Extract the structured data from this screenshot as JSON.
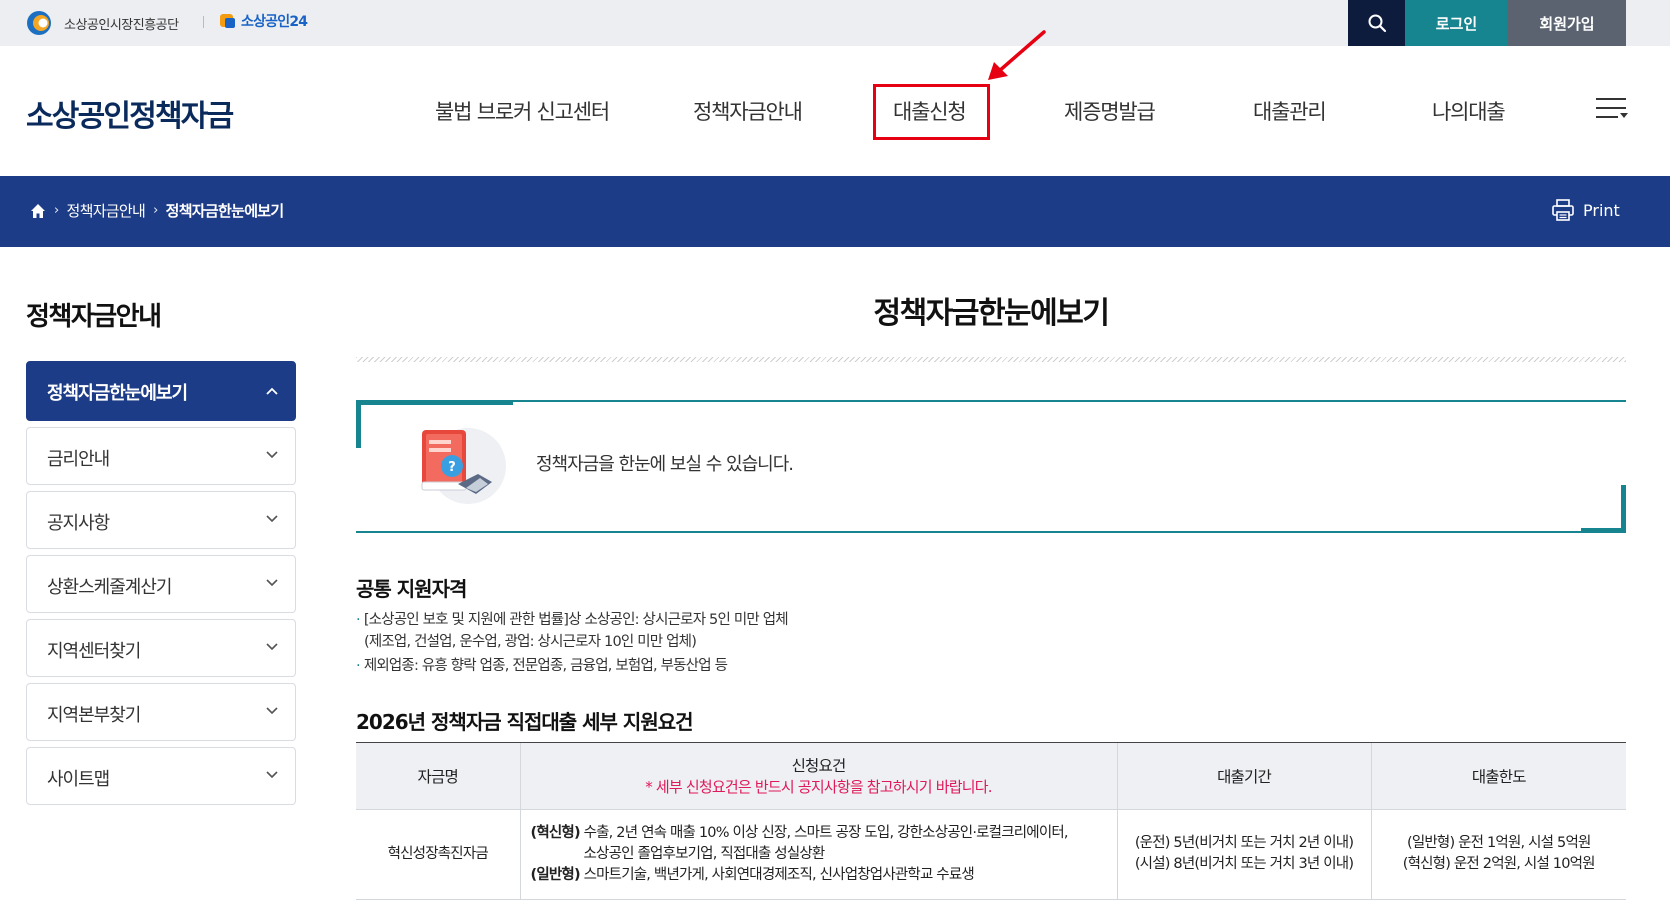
{
  "util": {
    "org_name": "소상공인시장진흥공단",
    "portal_name": "소상공인24",
    "login_label": "로그인",
    "join_label": "회원가입"
  },
  "header": {
    "site_title": "소상공인정책자금",
    "nav": [
      "불법 브로커 신고센터",
      "정책자금안내",
      "대출신청",
      "제증명발급",
      "대출관리",
      "나의대출"
    ]
  },
  "breadcrumb": {
    "items": [
      "정책자금안내",
      "정책자금한눈에보기"
    ],
    "print_label": "Print"
  },
  "sidebar": {
    "title": "정책자금안내",
    "items": [
      {
        "label": "정책자금한눈에보기",
        "active": true
      },
      {
        "label": "금리안내"
      },
      {
        "label": "공지사항"
      },
      {
        "label": "상환스케줄계산기"
      },
      {
        "label": "지역센터찾기"
      },
      {
        "label": "지역본부찾기"
      },
      {
        "label": "사이트맵"
      }
    ]
  },
  "main": {
    "page_title": "정책자금한눈에보기",
    "intro_text": "정책자금을 한눈에 보실 수 있습니다.",
    "common": {
      "title": "공통 지원자격",
      "line1": "[소상공인 보호 및 지원에 관한 법률]상 소상공인: 상시근로자 5인 미만 업체",
      "line1b": "(제조업, 건설업, 운수업, 광업: 상시근로자 10인 미만 업체)",
      "line2": "제외업종: 유흥 향락 업종, 전문업종, 금융업, 보험업, 부동산업 등"
    },
    "table_title": "2026년 정책자금 직접대출 세부 지원요건",
    "table": {
      "headers": {
        "name": "자금명",
        "req": "신청요건",
        "req_notice": "* 세부 신청요건은 반드시 공지사항을 참고하시기 바랍니다.",
        "period": "대출기간",
        "limit": "대출한도"
      },
      "rows": [
        {
          "name": "혁신성장촉진자금",
          "req_a_tag": "(혁신형)",
          "req_a": " 수출, 2년 연속 매출 10% 이상 신장, 스마트 공장 도입, 강한소상공인·로컬크리에이터,",
          "req_a2": "소상공인 졸업후보기업, 직접대출 성실상환",
          "req_b_tag": "(일반형)",
          "req_b": " 스마트기술, 백년가게, 사회연대경제조직, 신사업창업사관학교 수료생",
          "period1": "(운전) 5년(비거치 또는 거치 2년 이내)",
          "period2": "(시설) 8년(비거치 또는 거치 3년 이내)",
          "limit1": "(일반형) 운전 1억원, 시설 5억원",
          "limit2": "(혁신형) 운전 2억원, 시설 10억원"
        }
      ]
    }
  },
  "colors": {
    "navy": "#1d3c87",
    "teal": "#17858f",
    "highlight_red": "#e60012",
    "notice_pink": "#e0195a"
  }
}
